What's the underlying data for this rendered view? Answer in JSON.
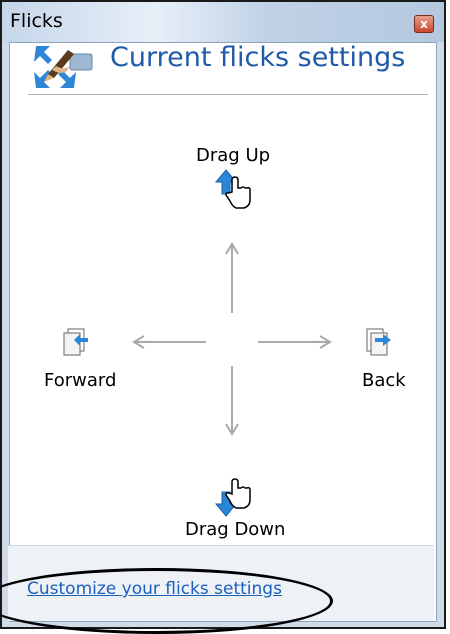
{
  "window": {
    "title": "Flicks",
    "close_symbol": "x"
  },
  "header": {
    "title": "Current flicks settings",
    "icon": "flicks-pen-arrows-icon"
  },
  "flicks": {
    "up": {
      "label": "Drag Up",
      "icon": "hand-drag-up-icon"
    },
    "down": {
      "label": "Drag Down",
      "icon": "hand-drag-down-icon"
    },
    "left": {
      "label": "Forward",
      "icon": "page-forward-icon"
    },
    "right": {
      "label": "Back",
      "icon": "page-back-icon"
    }
  },
  "footer": {
    "link": "Customize your flicks settings"
  },
  "colors": {
    "accent": "#1f5aa8",
    "link": "#1b5fbd",
    "arrow": "#a9a9a9",
    "icon_blue": "#2a86d6"
  }
}
